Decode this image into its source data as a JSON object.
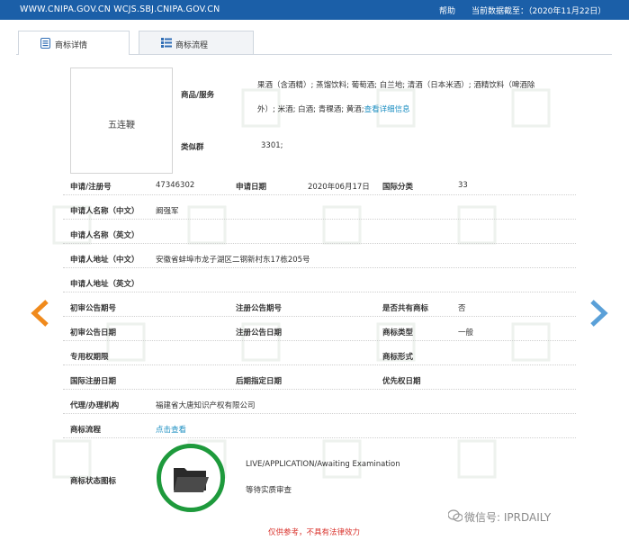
{
  "topbar": {
    "site": "WWW.CNIPA.GOV.CN WCJS.SBJ.CNIPA.GOV.CN",
    "help": "帮助",
    "data_cutoff": "当前数据截至：（2020年11月22日）"
  },
  "tabs": [
    {
      "label": "商标详情",
      "icon": "document-icon"
    },
    {
      "label": "商标流程",
      "icon": "list-icon"
    }
  ],
  "trademark": {
    "image_text": "五连鞭",
    "goods_label": "商品/服务",
    "goods_line1": "果酒（含酒精）; 蒸馏饮料; 葡萄酒; 白兰地; 清酒（日本米酒）; 酒精饮料（啤酒除",
    "goods_line2": "外）; 米酒; 白酒; 青稞酒; 黄酒;",
    "goods_more_link": "查看详细信息",
    "similar_group_label": "类似群",
    "similar_group_value": "3301;"
  },
  "fields": {
    "reg_no_label": "申请/注册号",
    "reg_no": "47346302",
    "app_date_label": "申请日期",
    "app_date": "2020年06月17日",
    "intl_class_label": "国际分类",
    "intl_class": "33",
    "applicant_cn_label": "申请人名称（中文）",
    "applicant_cn": "阚强军",
    "applicant_en_label": "申请人名称（英文）",
    "applicant_en": "",
    "address_cn_label": "申请人地址（中文）",
    "address_cn": "安徽省蚌埠市龙子湖区二钢新村东17栋205号",
    "address_en_label": "申请人地址（英文）",
    "address_en": "",
    "prelim_no_label": "初审公告期号",
    "prelim_no": "",
    "reg_pub_no_label": "注册公告期号",
    "reg_pub_no": "",
    "shared_label": "是否共有商标",
    "shared": "否",
    "prelim_date_label": "初审公告日期",
    "prelim_date": "",
    "reg_pub_date_label": "注册公告日期",
    "reg_pub_date": "",
    "tm_type_label": "商标类型",
    "tm_type": "一般",
    "exclusive_label": "专用权期限",
    "exclusive": "",
    "tm_form_label": "商标形式",
    "tm_form": "",
    "intl_reg_date_label": "国际注册日期",
    "intl_reg_date": "",
    "later_date_label": "后期指定日期",
    "later_date": "",
    "priority_label": "优先权日期",
    "priority": "",
    "agent_label": "代理/办理机构",
    "agent": "福建省大唐知识产权有限公司",
    "process_label": "商标流程",
    "process_link": "点击查看",
    "status_icon_label": "商标状态图标",
    "status_en": "LIVE/APPLICATION/Awaiting Examination",
    "status_cn": "等待实质审查"
  },
  "footer": {
    "notice": "仅供参考，不具有法律效力",
    "wechat": "微信号: IPRDAILY"
  },
  "colors": {
    "topbar": "#1b5fa8",
    "link": "#1d8fc2",
    "arrow_left": "#f08a1c",
    "arrow_right": "#5aa0d8",
    "status_ring": "#1e9a3c",
    "notice": "#d9302a"
  }
}
